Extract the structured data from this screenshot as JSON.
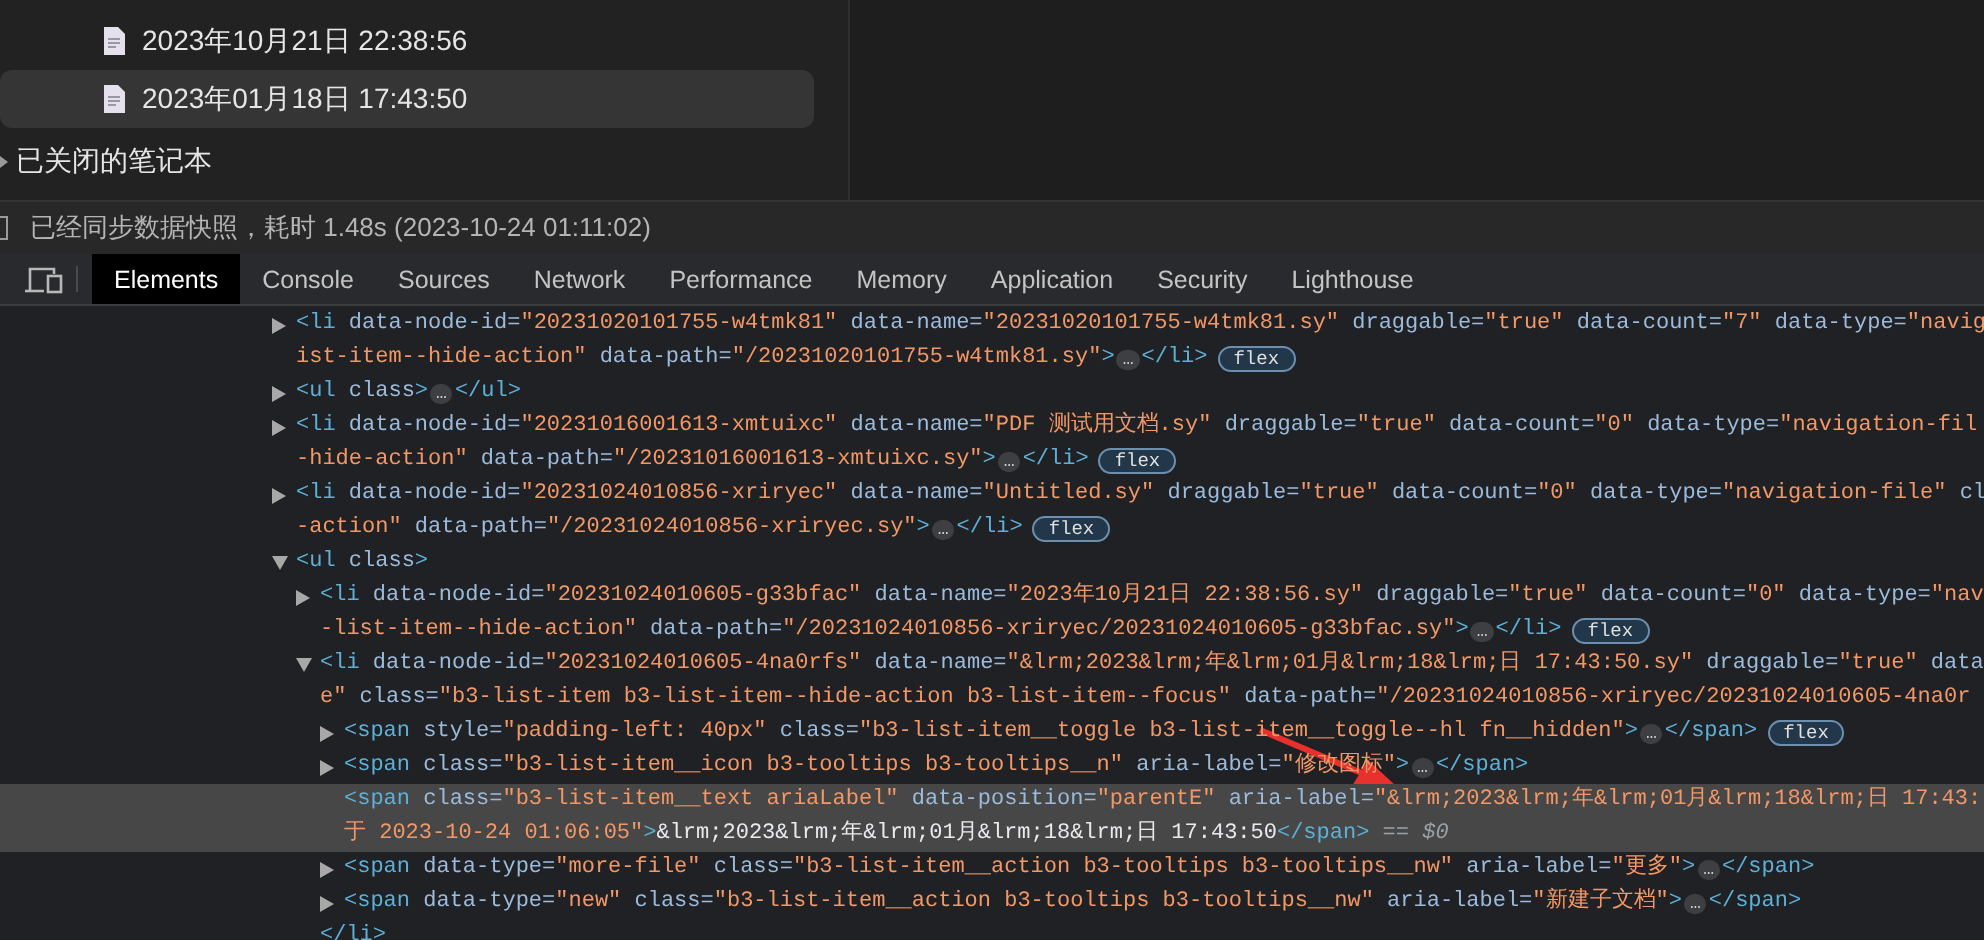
{
  "file_tree": {
    "files": [
      {
        "title": "2023年10月21日 22:38:56",
        "selected": false
      },
      {
        "title": "2023年01月18日 17:43:50",
        "selected": true
      }
    ],
    "closed_section": {
      "label": "已关闭的笔记本",
      "expanded": false
    }
  },
  "status_bar": {
    "message": "已经同步数据快照，耗时 1.48s (2023-10-24 01:11:02)"
  },
  "devtools": {
    "tabs": [
      {
        "label": "Elements",
        "selected": true
      },
      {
        "label": "Console",
        "selected": false
      },
      {
        "label": "Sources",
        "selected": false
      },
      {
        "label": "Network",
        "selected": false
      },
      {
        "label": "Performance",
        "selected": false
      },
      {
        "label": "Memory",
        "selected": false
      },
      {
        "label": "Application",
        "selected": false
      },
      {
        "label": "Security",
        "selected": false
      },
      {
        "label": "Lighthouse",
        "selected": false
      }
    ],
    "dom": {
      "nodes": [
        {
          "expanded": false,
          "selected": false,
          "lines": [
            [
              {
                "kind": "tag",
                "text": "<li"
              },
              {
                "kind": "attr",
                "text": " data-node-id="
              },
              {
                "kind": "value",
                "text": "\"20231020101755-w4tmk81\""
              },
              {
                "kind": "attr",
                "text": " data-name="
              },
              {
                "kind": "value",
                "text": "\"20231020101755-w4tmk81.sy\""
              },
              {
                "kind": "attr",
                "text": " draggable="
              },
              {
                "kind": "value",
                "text": "\"true\""
              },
              {
                "kind": "attr",
                "text": " data-count="
              },
              {
                "kind": "value",
                "text": "\"7\""
              },
              {
                "kind": "attr",
                "text": " data-type="
              },
              {
                "kind": "value",
                "text": "\"navig"
              }
            ],
            [
              {
                "kind": "value",
                "text": "ist-item--hide-action\""
              },
              {
                "kind": "attr",
                "text": " data-path="
              },
              {
                "kind": "value",
                "text": "\"/20231020101755-w4tmk81.sy\""
              },
              {
                "kind": "tag",
                "text": ">"
              },
              {
                "kind": "ellipsis",
                "text": "…"
              },
              {
                "kind": "tag",
                "text": "</li>"
              },
              {
                "kind": "badge",
                "text": "flex"
              }
            ]
          ]
        },
        {
          "expanded": false,
          "selected": false,
          "lines": [
            [
              {
                "kind": "tag",
                "text": "<ul"
              },
              {
                "kind": "attr",
                "text": " class"
              },
              {
                "kind": "tag",
                "text": ">"
              },
              {
                "kind": "ellipsis",
                "text": "…"
              },
              {
                "kind": "tag",
                "text": "</ul>"
              }
            ]
          ]
        },
        {
          "expanded": false,
          "selected": false,
          "lines": [
            [
              {
                "kind": "tag",
                "text": "<li"
              },
              {
                "kind": "attr",
                "text": " data-node-id="
              },
              {
                "kind": "value",
                "text": "\"20231016001613-xmtuixc\""
              },
              {
                "kind": "attr",
                "text": " data-name="
              },
              {
                "kind": "value",
                "text": "\"PDF 测试用文档.sy\""
              },
              {
                "kind": "attr",
                "text": " draggable="
              },
              {
                "kind": "value",
                "text": "\"true\""
              },
              {
                "kind": "attr",
                "text": " data-count="
              },
              {
                "kind": "value",
                "text": "\"0\""
              },
              {
                "kind": "attr",
                "text": " data-type="
              },
              {
                "kind": "value",
                "text": "\"navigation-fil"
              }
            ],
            [
              {
                "kind": "value",
                "text": "-hide-action\""
              },
              {
                "kind": "attr",
                "text": " data-path="
              },
              {
                "kind": "value",
                "text": "\"/20231016001613-xmtuixc.sy\""
              },
              {
                "kind": "tag",
                "text": ">"
              },
              {
                "kind": "ellipsis",
                "text": "…"
              },
              {
                "kind": "tag",
                "text": "</li>"
              },
              {
                "kind": "badge",
                "text": "flex"
              }
            ]
          ]
        },
        {
          "expanded": false,
          "selected": false,
          "lines": [
            [
              {
                "kind": "tag",
                "text": "<li"
              },
              {
                "kind": "attr",
                "text": " data-node-id="
              },
              {
                "kind": "value",
                "text": "\"20231024010856-xriryec\""
              },
              {
                "kind": "attr",
                "text": " data-name="
              },
              {
                "kind": "value",
                "text": "\"Untitled.sy\""
              },
              {
                "kind": "attr",
                "text": " draggable="
              },
              {
                "kind": "value",
                "text": "\"true\""
              },
              {
                "kind": "attr",
                "text": " data-count="
              },
              {
                "kind": "value",
                "text": "\"0\""
              },
              {
                "kind": "attr",
                "text": " data-type="
              },
              {
                "kind": "value",
                "text": "\"navigation-file\""
              },
              {
                "kind": "attr",
                "text": " cl"
              }
            ],
            [
              {
                "kind": "value",
                "text": "-action\""
              },
              {
                "kind": "attr",
                "text": " data-path="
              },
              {
                "kind": "value",
                "text": "\"/20231024010856-xriryec.sy\""
              },
              {
                "kind": "tag",
                "text": ">"
              },
              {
                "kind": "ellipsis",
                "text": "…"
              },
              {
                "kind": "tag",
                "text": "</li>"
              },
              {
                "kind": "badge",
                "text": "flex"
              }
            ]
          ]
        },
        {
          "expanded": true,
          "selected": false,
          "lines": [
            [
              {
                "kind": "tag",
                "text": "<ul"
              },
              {
                "kind": "attr",
                "text": " class"
              },
              {
                "kind": "tag",
                "text": ">"
              }
            ]
          ],
          "children": [
            {
              "expanded": false,
              "selected": false,
              "lines": [
                [
                  {
                    "kind": "tag",
                    "text": "<li"
                  },
                  {
                    "kind": "attr",
                    "text": " data-node-id="
                  },
                  {
                    "kind": "value",
                    "text": "\"20231024010605-g33bfac\""
                  },
                  {
                    "kind": "attr",
                    "text": " data-name="
                  },
                  {
                    "kind": "value",
                    "text": "\"2023年10月21日 22:38:56.sy\""
                  },
                  {
                    "kind": "attr",
                    "text": " draggable="
                  },
                  {
                    "kind": "value",
                    "text": "\"true\""
                  },
                  {
                    "kind": "attr",
                    "text": " data-count="
                  },
                  {
                    "kind": "value",
                    "text": "\"0\""
                  },
                  {
                    "kind": "attr",
                    "text": " data-type="
                  },
                  {
                    "kind": "value",
                    "text": "\"nav"
                  }
                ],
                [
                  {
                    "kind": "value",
                    "text": "-list-item--hide-action\""
                  },
                  {
                    "kind": "attr",
                    "text": " data-path="
                  },
                  {
                    "kind": "value",
                    "text": "\"/20231024010856-xriryec/20231024010605-g33bfac.sy\""
                  },
                  {
                    "kind": "tag",
                    "text": ">"
                  },
                  {
                    "kind": "ellipsis",
                    "text": "…"
                  },
                  {
                    "kind": "tag",
                    "text": "</li>"
                  },
                  {
                    "kind": "badge",
                    "text": "flex"
                  }
                ]
              ]
            },
            {
              "expanded": true,
              "selected": false,
              "lines": [
                [
                  {
                    "kind": "tag",
                    "text": "<li"
                  },
                  {
                    "kind": "attr",
                    "text": " data-node-id="
                  },
                  {
                    "kind": "value",
                    "text": "\"20231024010605-4na0rfs\""
                  },
                  {
                    "kind": "attr",
                    "text": " data-name="
                  },
                  {
                    "kind": "value",
                    "text": "\"&lrm;2023&lrm;年&lrm;01月&lrm;18&lrm;日 17:43:50.sy\""
                  },
                  {
                    "kind": "attr",
                    "text": " draggable="
                  },
                  {
                    "kind": "value",
                    "text": "\"true\""
                  },
                  {
                    "kind": "attr",
                    "text": " data"
                  }
                ],
                [
                  {
                    "kind": "value",
                    "text": "e\""
                  },
                  {
                    "kind": "attr",
                    "text": " class="
                  },
                  {
                    "kind": "value",
                    "text": "\"b3-list-item b3-list-item--hide-action b3-list-item--focus\""
                  },
                  {
                    "kind": "attr",
                    "text": " data-path="
                  },
                  {
                    "kind": "value",
                    "text": "\"/20231024010856-xriryec/20231024010605-4na0r"
                  }
                ]
              ],
              "children": [
                {
                  "expanded": false,
                  "selected": false,
                  "lines": [
                    [
                      {
                        "kind": "tag",
                        "text": "<span"
                      },
                      {
                        "kind": "attr",
                        "text": " style="
                      },
                      {
                        "kind": "value",
                        "text": "\"padding-left: 40px\""
                      },
                      {
                        "kind": "attr",
                        "text": " class="
                      },
                      {
                        "kind": "value",
                        "text": "\"b3-list-item__toggle b3-list-item__toggle--hl fn__hidden\""
                      },
                      {
                        "kind": "tag",
                        "text": ">"
                      },
                      {
                        "kind": "ellipsis",
                        "text": "…"
                      },
                      {
                        "kind": "tag",
                        "text": "</span>"
                      },
                      {
                        "kind": "badge",
                        "text": "flex"
                      }
                    ]
                  ]
                },
                {
                  "expanded": false,
                  "selected": false,
                  "lines": [
                    [
                      {
                        "kind": "tag",
                        "text": "<span"
                      },
                      {
                        "kind": "attr",
                        "text": " class="
                      },
                      {
                        "kind": "value",
                        "text": "\"b3-list-item__icon b3-tooltips b3-tooltips__n\""
                      },
                      {
                        "kind": "attr",
                        "text": " aria-label="
                      },
                      {
                        "kind": "value",
                        "text": "\"修改图标\""
                      },
                      {
                        "kind": "tag",
                        "text": ">"
                      },
                      {
                        "kind": "ellipsis",
                        "text": "…"
                      },
                      {
                        "kind": "tag",
                        "text": "</span>"
                      }
                    ]
                  ]
                },
                {
                  "selected": true,
                  "lines": [
                    [
                      {
                        "kind": "tag",
                        "text": "<span"
                      },
                      {
                        "kind": "attr",
                        "text": " class="
                      },
                      {
                        "kind": "value",
                        "text": "\"b3-list-item__text ariaLabel\""
                      },
                      {
                        "kind": "attr",
                        "text": " data-position="
                      },
                      {
                        "kind": "value",
                        "text": "\"parentE\""
                      },
                      {
                        "kind": "attr",
                        "text": " aria-label="
                      },
                      {
                        "kind": "value",
                        "text": "\"&lrm;2023&lrm;年&lrm;01月&lrm;18&lrm;日 17:43:"
                      }
                    ],
                    [
                      {
                        "kind": "value",
                        "text": "于 2023-10-24 01:06:05\""
                      },
                      {
                        "kind": "tag",
                        "text": ">"
                      },
                      {
                        "kind": "text",
                        "text": "&lrm;2023&lrm;年&lrm;01月&lrm;18&lrm;日 17:43:50"
                      },
                      {
                        "kind": "tag",
                        "text": "</span>"
                      },
                      {
                        "kind": "note",
                        "text": " == $0"
                      }
                    ]
                  ]
                },
                {
                  "expanded": false,
                  "selected": false,
                  "lines": [
                    [
                      {
                        "kind": "tag",
                        "text": "<span"
                      },
                      {
                        "kind": "attr",
                        "text": " data-type="
                      },
                      {
                        "kind": "value",
                        "text": "\"more-file\""
                      },
                      {
                        "kind": "attr",
                        "text": " class="
                      },
                      {
                        "kind": "value",
                        "text": "\"b3-list-item__action b3-tooltips b3-tooltips__nw\""
                      },
                      {
                        "kind": "attr",
                        "text": " aria-label="
                      },
                      {
                        "kind": "value",
                        "text": "\"更多\""
                      },
                      {
                        "kind": "tag",
                        "text": ">"
                      },
                      {
                        "kind": "ellipsis",
                        "text": "…"
                      },
                      {
                        "kind": "tag",
                        "text": "</span>"
                      }
                    ]
                  ]
                },
                {
                  "expanded": false,
                  "selected": false,
                  "lines": [
                    [
                      {
                        "kind": "tag",
                        "text": "<span"
                      },
                      {
                        "kind": "attr",
                        "text": " data-type="
                      },
                      {
                        "kind": "value",
                        "text": "\"new\""
                      },
                      {
                        "kind": "attr",
                        "text": " class="
                      },
                      {
                        "kind": "value",
                        "text": "\"b3-list-item__action b3-tooltips b3-tooltips__nw\""
                      },
                      {
                        "kind": "attr",
                        "text": " aria-label="
                      },
                      {
                        "kind": "value",
                        "text": "\"新建子文档\""
                      },
                      {
                        "kind": "tag",
                        "text": ">"
                      },
                      {
                        "kind": "ellipsis",
                        "text": "…"
                      },
                      {
                        "kind": "tag",
                        "text": "</span>"
                      }
                    ]
                  ]
                }
              ],
              "end": [
                {
                  "kind": "tag",
                  "text": "</li>"
                }
              ]
            }
          ]
        }
      ]
    }
  }
}
